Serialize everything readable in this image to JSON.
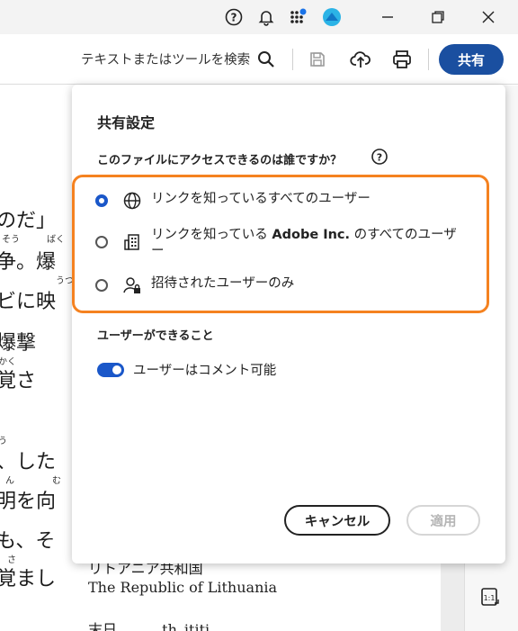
{
  "toolbar": {
    "search_placeholder": "テキストまたはツールを検索",
    "share_label": "共有"
  },
  "document": {
    "lines": [
      "のだ」",
      "争。爆",
      "ビに映",
      "爆撃",
      "覚さ",
      "、した",
      "明を向",
      "も、そ",
      "覚まし"
    ],
    "ruby": [
      "そう",
      "ばく",
      "うつ",
      "かく",
      "う",
      "ん",
      "む",
      "さ"
    ],
    "bottom_line1": "リトアニア共和国",
    "bottom_line2": "The Republic of Lithuania",
    "bottom_line3": "末日 _____ th_ititi"
  },
  "dialog": {
    "title": "共有設定",
    "question": "このファイルにアクセスできるのは誰ですか？",
    "options": [
      {
        "label": "リンクを知っているすべてのユーザー",
        "icon": "globe-icon",
        "selected": true
      },
      {
        "label_pre": "リンクを知っている ",
        "label_bold": "Adobe Inc.",
        "label_post": " のすべてのユーザー",
        "icon": "building-icon",
        "selected": false
      },
      {
        "label": "招待されたユーザーのみ",
        "icon": "user-lock-icon",
        "selected": false
      }
    ],
    "permissions_title": "ユーザーができること",
    "toggle_label": "ユーザーはコメント可能",
    "toggle_on": true,
    "cancel_label": "キャンセル",
    "apply_label": "適用"
  },
  "colors": {
    "accent": "#1a57c9",
    "share_button": "#1a4fa0",
    "highlight": "#f58220"
  }
}
